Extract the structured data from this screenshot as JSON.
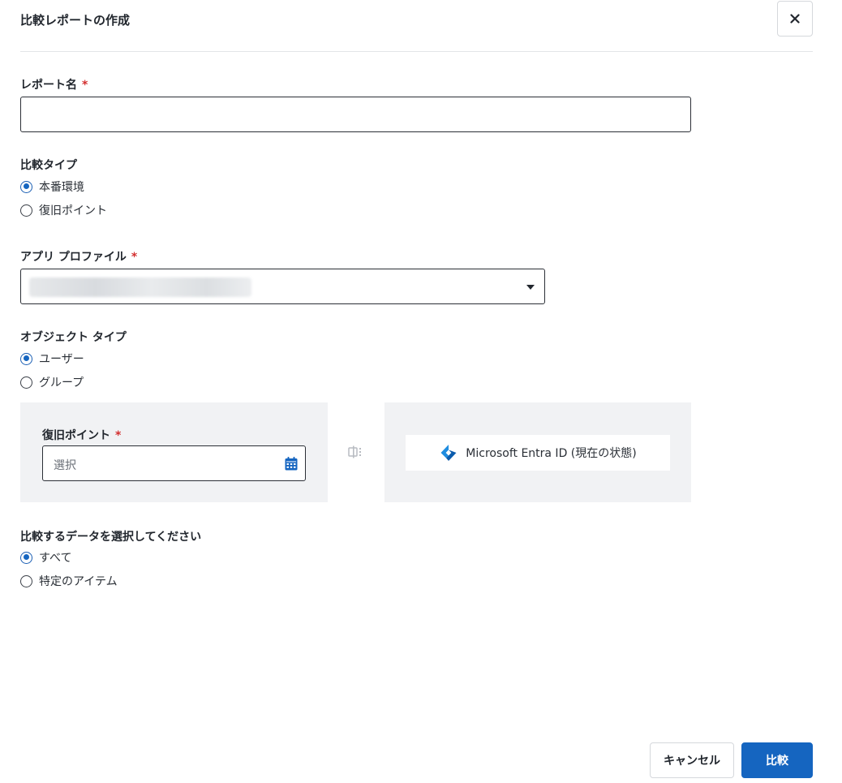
{
  "dialog": {
    "title": "比較レポートの作成"
  },
  "report_name": {
    "label": "レポート名",
    "required_mark": "*",
    "value": ""
  },
  "comparison_type": {
    "label": "比較タイプ",
    "options": [
      {
        "label": "本番環境",
        "selected": true
      },
      {
        "label": "復旧ポイント",
        "selected": false
      }
    ]
  },
  "app_profile": {
    "label": "アプリ プロファイル",
    "required_mark": "*",
    "value_redacted": true
  },
  "object_type": {
    "label": "オブジェクト タイプ",
    "options": [
      {
        "label": "ユーザー",
        "selected": true
      },
      {
        "label": "グループ",
        "selected": false
      }
    ]
  },
  "restore_point": {
    "label": "復旧ポイント",
    "required_mark": "*",
    "placeholder": "選択",
    "icon": "calendar-icon"
  },
  "compare_target": {
    "label": "Microsoft Entra ID (現在の状態)",
    "icon": "microsoft-entra-icon",
    "icon_color": "#1f8de0"
  },
  "compare_data": {
    "label": "比較するデータを選択してください",
    "options": [
      {
        "label": "すべて",
        "selected": true
      },
      {
        "label": "特定のアイテム",
        "selected": false
      }
    ]
  },
  "footer": {
    "cancel_label": "キャンセル",
    "compare_label": "比較"
  },
  "colors": {
    "primary": "#1565c0",
    "required": "#d32f2f",
    "panel_bg": "#f1f2f4"
  }
}
